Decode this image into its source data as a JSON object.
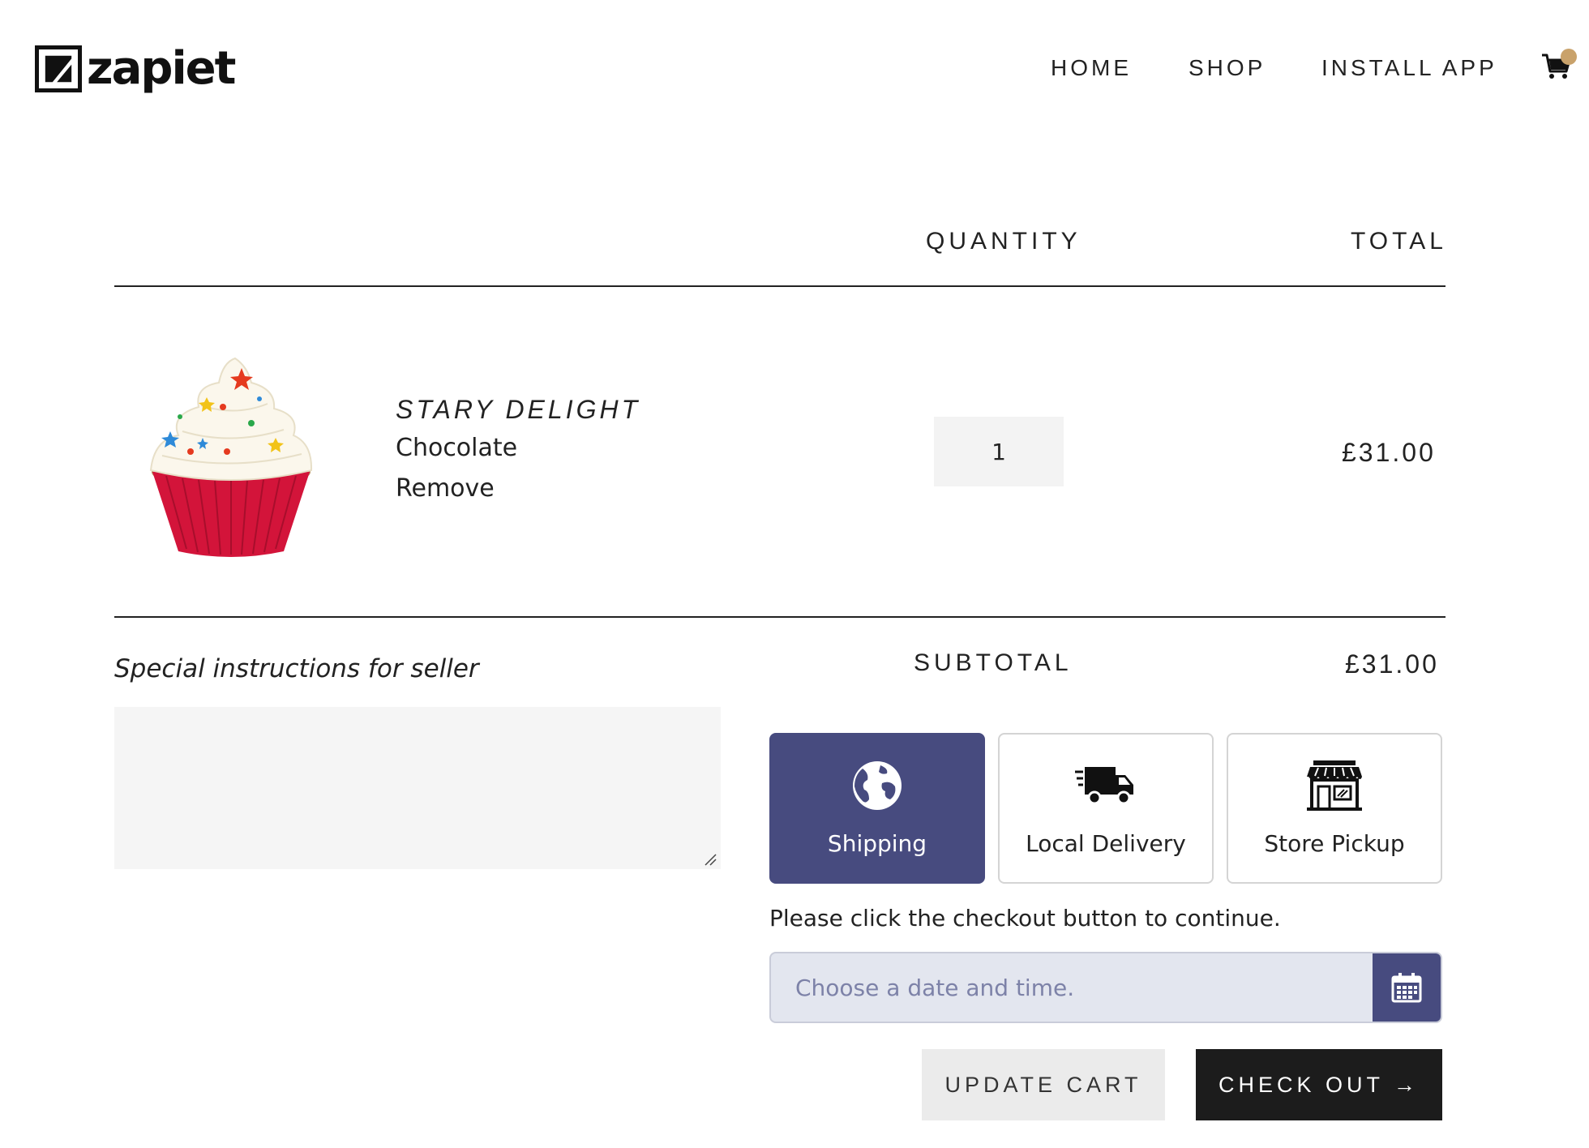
{
  "header": {
    "logo_text": "zapiet",
    "nav": [
      {
        "label": "HOME"
      },
      {
        "label": "SHOP"
      },
      {
        "label": "INSTALL APP"
      }
    ],
    "cart_badge_color": "#c9a26b"
  },
  "cart": {
    "columns": {
      "quantity": "QUANTITY",
      "total": "TOTAL"
    },
    "items": [
      {
        "title": "STARY DELIGHT",
        "variant": "Chocolate",
        "remove_label": "Remove",
        "quantity": "1",
        "line_total": "£31.00",
        "image": "cupcake-image"
      }
    ],
    "subtotal_label": "SUBTOTAL",
    "subtotal_value": "£31.00"
  },
  "notes": {
    "label": "Special instructions for seller",
    "value": ""
  },
  "delivery": {
    "methods": [
      {
        "label": "Shipping",
        "icon": "globe-icon",
        "selected": true
      },
      {
        "label": "Local Delivery",
        "icon": "truck-icon",
        "selected": false
      },
      {
        "label": "Store Pickup",
        "icon": "store-icon",
        "selected": false
      }
    ],
    "message": "Please click the checkout button to continue.",
    "date_placeholder": "Choose a date and time.",
    "accent": "#474b7f"
  },
  "actions": {
    "update_label": "UPDATE CART",
    "checkout_label": "CHECK OUT →"
  }
}
